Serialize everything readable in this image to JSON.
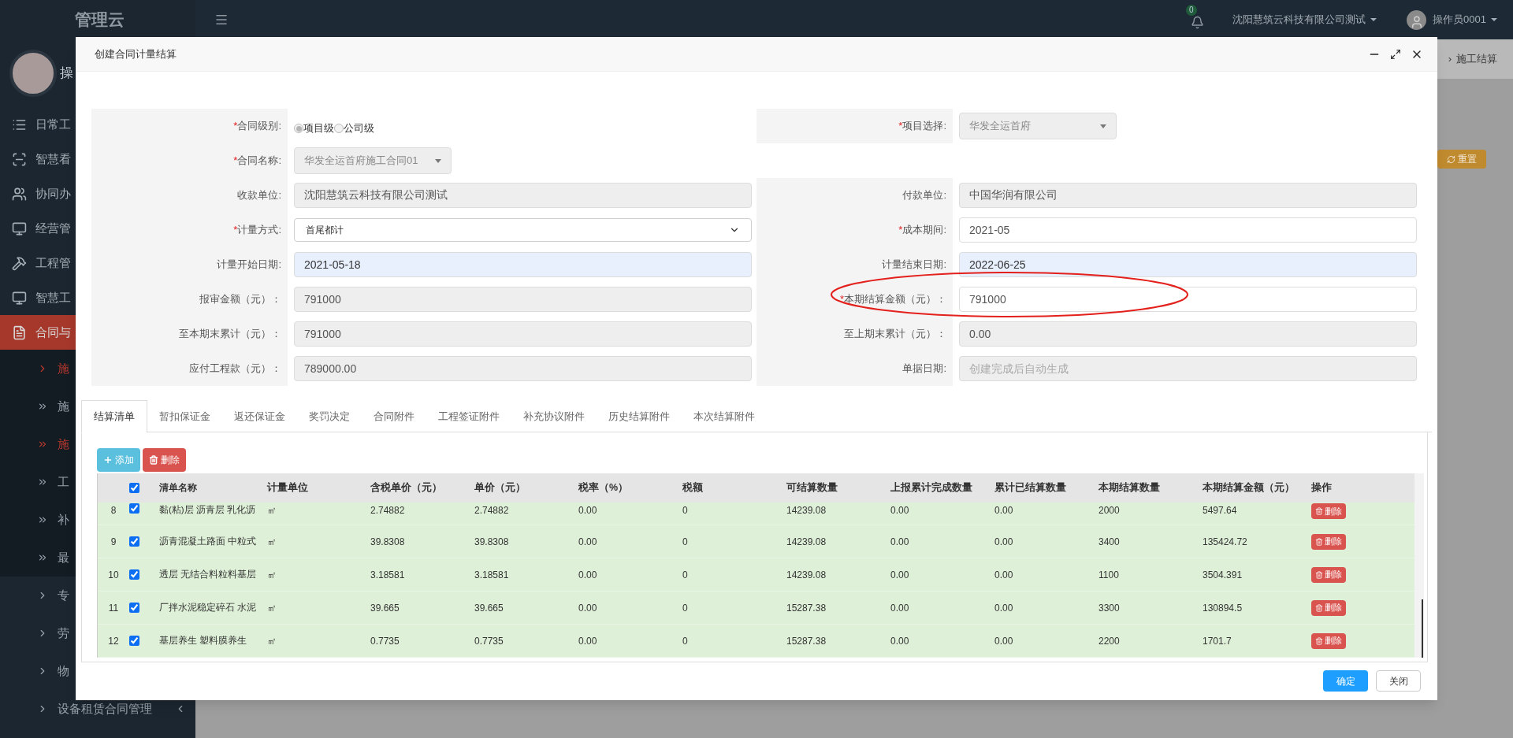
{
  "sidebar": {
    "logo": "管理云",
    "user_name": "操",
    "items": [
      {
        "kind": "main",
        "label": "日常工",
        "selected": false
      },
      {
        "kind": "main",
        "label": "智慧看",
        "selected": false
      },
      {
        "kind": "main",
        "label": "协同办",
        "selected": false
      },
      {
        "kind": "main",
        "label": "经营管",
        "selected": false
      },
      {
        "kind": "main",
        "label": "工程管",
        "selected": false
      },
      {
        "kind": "main",
        "label": "智慧工",
        "selected": false
      },
      {
        "kind": "main",
        "label": "合同与",
        "selected": true,
        "children": [
          {
            "kind": "link",
            "label": "施",
            "selected": true
          },
          {
            "kind": "page",
            "label": "施",
            "selected": false
          },
          {
            "kind": "page",
            "label": "施",
            "selected": true
          },
          {
            "kind": "page",
            "label": "工",
            "selected": false
          },
          {
            "kind": "page",
            "label": "补",
            "selected": false
          },
          {
            "kind": "page",
            "label": "最",
            "selected": false
          }
        ]
      },
      {
        "kind": "link",
        "label": "专",
        "selected": false
      },
      {
        "kind": "link",
        "label": "劳",
        "selected": false
      },
      {
        "kind": "link",
        "label": "物",
        "selected": false
      },
      {
        "kind": "group",
        "label": "设备租赁合同管理",
        "selected": false
      }
    ]
  },
  "top_bar": {
    "notification_count": "0",
    "company": "沈阳慧筑云科技有限公司测试",
    "user": "操作员0001"
  },
  "background": {
    "breadcrumb_separator": "›",
    "breadcrumb_current": "施工结算",
    "reset_button": "重置"
  },
  "modal": {
    "title": "创建合同计量结算",
    "form": {
      "rows": [
        {
          "left": {
            "mark": "*",
            "label": "合同级别:",
            "kind": "radio",
            "options": [
              {
                "label": "项目级",
                "selected": true
              },
              {
                "label": "公司级",
                "selected": false
              }
            ]
          },
          "right": {
            "mark": "*",
            "label": "项目选择:",
            "kind": "dropdown",
            "value": "华发全运首府"
          }
        },
        {
          "left": {
            "mark": "*",
            "label": "合同名称:",
            "kind": "dropdown",
            "value": "华发全运首府施工合同01"
          }
        },
        {
          "left": {
            "label": "收款单位:",
            "kind": "text",
            "value": "沈阳慧筑云科技有限公司测试",
            "disabled": true
          },
          "right": {
            "label": "付款单位:",
            "kind": "text",
            "value": "中国华润有限公司",
            "disabled": true
          }
        },
        {
          "left": {
            "mark": "*",
            "label": "计量方式:",
            "kind": "select",
            "value": "首尾都计"
          },
          "right": {
            "mark": "*",
            "label": "成本期间:",
            "kind": "text",
            "value": "2021-05",
            "disabled": false
          }
        },
        {
          "left": {
            "label": "计量开始日期:",
            "kind": "date",
            "value": "2021-05-18"
          },
          "right": {
            "label": "计量结束日期:",
            "kind": "date",
            "value": "2022-06-25"
          }
        },
        {
          "left": {
            "label": "报审金额（元）：",
            "kind": "text",
            "value": "791000",
            "disabled": true
          },
          "right": {
            "mark": "*",
            "label": "本期结算金额（元）：",
            "kind": "text",
            "value": "791000",
            "disabled": false
          }
        },
        {
          "left": {
            "label": "至本期末累计（元）：",
            "kind": "text",
            "value": "791000",
            "disabled": true
          },
          "right": {
            "label": "至上期末累计（元）：",
            "kind": "text",
            "value": "0.00",
            "disabled": true
          }
        },
        {
          "left": {
            "label": "应付工程款（元）：",
            "kind": "text",
            "value": "789000.00",
            "disabled": true
          },
          "right": {
            "label": "单据日期:",
            "kind": "text",
            "placeholder": "创建完成后自动生成",
            "disabled": true
          }
        }
      ]
    },
    "annotation": {
      "kind": "ellipse"
    },
    "tabs": [
      {
        "label": "结算清单",
        "selected": true
      },
      {
        "label": "暂扣保证金",
        "selected": false
      },
      {
        "label": "返还保证金",
        "selected": false
      },
      {
        "label": "奖罚决定",
        "selected": false
      },
      {
        "label": "合同附件",
        "selected": false
      },
      {
        "label": "工程签证附件",
        "selected": false
      },
      {
        "label": "补充协议附件",
        "selected": false
      },
      {
        "label": "历史结算附件",
        "selected": false
      },
      {
        "label": "本次结算附件",
        "selected": false
      }
    ],
    "toolbar": [
      {
        "kind": "add",
        "label": "添加"
      },
      {
        "kind": "delete",
        "label": "删除"
      }
    ],
    "table": {
      "all_checked": true,
      "columns": [
        "清单名称",
        "计量单位",
        "含税单价（元）",
        "单价（元）",
        "税率（%）",
        "税额",
        "可结算数量",
        "上报累计完成数量",
        "累计已结算数量",
        "本期结算数量",
        "本期结算金额（元）",
        "操作"
      ],
      "rows": [
        {
          "index": "8",
          "checked": true,
          "cells": [
            "黏(粘)层 沥青层 乳化沥",
            "㎡",
            "2.74882",
            "2.74882",
            "0.00",
            "0",
            "14239.08",
            "0.00",
            "0.00",
            "2000",
            "5497.64"
          ],
          "action": "删除"
        },
        {
          "index": "9",
          "checked": true,
          "cells": [
            "沥青混凝土路面 中粒式",
            "㎡",
            "39.8308",
            "39.8308",
            "0.00",
            "0",
            "14239.08",
            "0.00",
            "0.00",
            "3400",
            "135424.72"
          ],
          "action": "删除"
        },
        {
          "index": "10",
          "checked": true,
          "cells": [
            "透层 无结合料粒料基层",
            "㎡",
            "3.18581",
            "3.18581",
            "0.00",
            "0",
            "14239.08",
            "0.00",
            "0.00",
            "1100",
            "3504.391"
          ],
          "action": "删除"
        },
        {
          "index": "11",
          "checked": true,
          "cells": [
            "厂拌水泥稳定碎石 水泥",
            "㎡",
            "39.665",
            "39.665",
            "0.00",
            "0",
            "15287.38",
            "0.00",
            "0.00",
            "3300",
            "130894.5"
          ],
          "action": "删除"
        },
        {
          "index": "12",
          "checked": true,
          "cells": [
            "基层养生 塑料膜养生",
            "㎡",
            "0.7735",
            "0.7735",
            "0.00",
            "0",
            "15287.38",
            "0.00",
            "0.00",
            "2200",
            "1701.7"
          ],
          "action": "删除"
        }
      ]
    },
    "footer": [
      {
        "kind": "primary",
        "label": "确定"
      },
      {
        "kind": "default",
        "label": "关闭"
      }
    ]
  }
}
